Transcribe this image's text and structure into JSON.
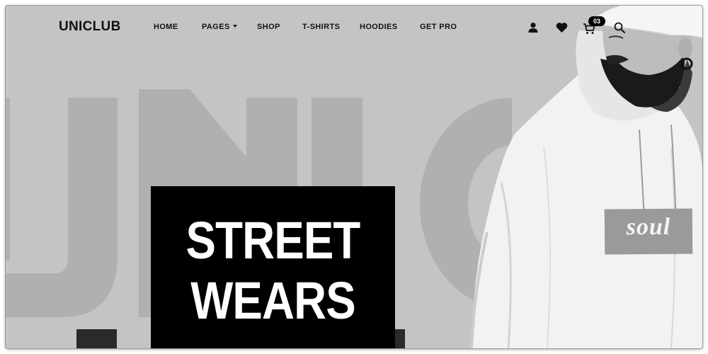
{
  "brand": {
    "logo_text": "UNICLUB"
  },
  "nav": {
    "items": [
      {
        "label": "HOME",
        "dropdown": false
      },
      {
        "label": "PAGES",
        "dropdown": true
      },
      {
        "label": "SHOP",
        "dropdown": false
      },
      {
        "label": "T-SHIRTS",
        "dropdown": false
      },
      {
        "label": "HOODIES",
        "dropdown": false
      },
      {
        "label": "GET PRO",
        "dropdown": false
      }
    ],
    "icons": [
      "user-icon",
      "heart-icon",
      "cart-icon",
      "search-icon"
    ],
    "cart_count": "03"
  },
  "hero": {
    "background_word": "UNIC",
    "title_line1": "STREET",
    "title_line2": "WEARS",
    "hoodie_print": "soul"
  },
  "colors": {
    "background": "#c4c4c4",
    "watermark": "#b0b0b0",
    "text": "#111111",
    "hero_box": "#000000",
    "hero_text": "#ffffff"
  }
}
